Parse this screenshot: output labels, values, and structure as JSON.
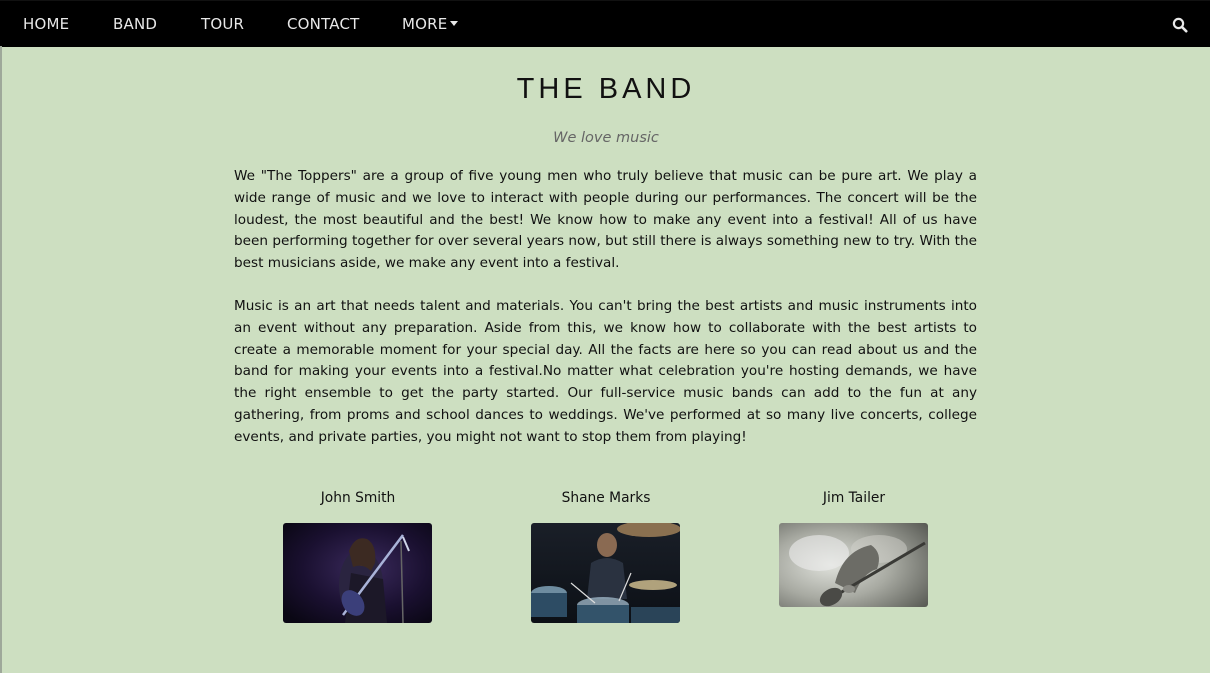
{
  "nav": {
    "items": [
      {
        "label": "HOME"
      },
      {
        "label": "BAND"
      },
      {
        "label": "TOUR"
      },
      {
        "label": "CONTACT"
      },
      {
        "label": "MORE"
      }
    ],
    "search_icon": "search-icon",
    "more_icon": "caret-down-icon"
  },
  "main": {
    "title": "THE BAND",
    "subtitle": "We love music",
    "paragraphs": [
      "We \"The Toppers\" are a group of five young men who truly believe that music can be pure art. We play a wide range of music and we love to interact with people during our performances. The concert will be the loudest, the most beautiful and the best! We know how to make any event into a festival! All of us have been performing together for over several years now, but still there is always something new to try. With the best musicians aside, we make any event into a festival.",
      "Music is an art that needs talent and materials. You can't bring the best artists and music instruments into an event without any preparation. Aside from this, we know how to collaborate with the best artists to create a memorable moment for your special day. All the facts are here so you can read about us and the band for making your events into a festival.No matter what celebration you're hosting demands, we have the right ensemble to get the party started. Our full-service music bands can add to the fun at any gathering, from proms and school dances to weddings. We've performed at so many live concerts, college events, and private parties, you might not want to stop them from playing!"
    ]
  },
  "members": [
    {
      "name": "John Smith"
    },
    {
      "name": "Shane Marks"
    },
    {
      "name": "Jim Tailer"
    }
  ],
  "colors": {
    "navbar": "#000000",
    "background": "#cddfc1",
    "text": "#111111"
  }
}
